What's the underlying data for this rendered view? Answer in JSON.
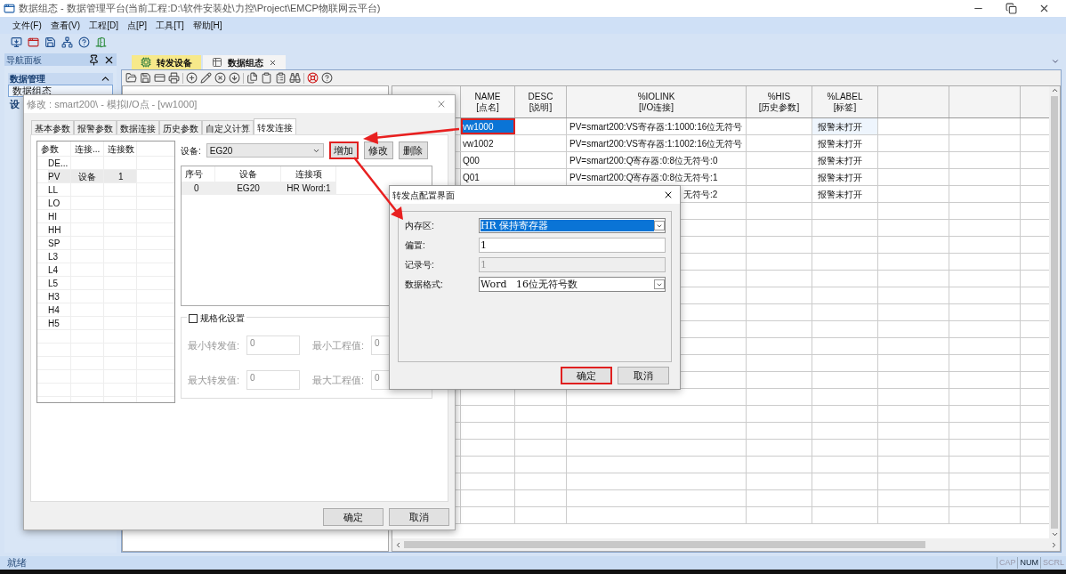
{
  "window": {
    "title": "数据组态 - 数据管理平台(当前工程:D:\\软件安装处\\力控\\Project\\EMCP物联网云平台)"
  },
  "menu": [
    "文件(F)",
    "查看(V)",
    "工程[D]",
    "点[P]",
    "工具[T]",
    "帮助[H]"
  ],
  "nav_panel": {
    "title": "导航面板",
    "section": "数据管理",
    "items": [
      {
        "label": "数据组态",
        "selected": true
      }
    ],
    "section_2": "设"
  },
  "doc_tabs": [
    {
      "label": "转发设备",
      "selected": false,
      "closable": false
    },
    {
      "label": "数据组态",
      "selected": true,
      "closable": true
    }
  ],
  "grid": {
    "columns": [
      {
        "name": "NAME",
        "sub": "[点名]"
      },
      {
        "name": "DESC",
        "sub": "[说明]"
      },
      {
        "name": "%IOLINK",
        "sub": "[I/O连接]"
      },
      {
        "name": "%HIS",
        "sub": "[历史参数]"
      },
      {
        "name": "%LABEL",
        "sub": "[标签]"
      }
    ],
    "rows": [
      {
        "name": "vw1000",
        "selected": true,
        "iolink": "PV=smart200:VS寄存器:1:1000:16位无符号",
        "label": "报警未打开"
      },
      {
        "name": "vw1002",
        "selected": false,
        "iolink": "PV=smart200:VS寄存器:1:1002:16位无符号",
        "label": "报警未打开"
      },
      {
        "name": "Q00",
        "selected": false,
        "iolink": "PV=smart200:Q寄存器:0:8位无符号:0",
        "label": "报警未打开"
      },
      {
        "name": "Q01",
        "selected": false,
        "iolink": "PV=smart200:Q寄存器:0:8位无符号:1",
        "label": "报警未打开"
      },
      {
        "selected": false,
        "iolink": "无符号:2",
        "label": "报警未打开"
      }
    ]
  },
  "status_bar": {
    "text": "就绪",
    "indicators": [
      {
        "label": "CAP",
        "on": false
      },
      {
        "label": "NUM",
        "on": true
      },
      {
        "label": "SCRL",
        "on": false
      }
    ]
  },
  "dialog": {
    "title": "修改 : smart200\\ - 模拟I/O点 - [vw1000]",
    "tabs": [
      {
        "label": "基本参数",
        "selected": false
      },
      {
        "label": "报警参数",
        "selected": false
      },
      {
        "label": "数据连接",
        "selected": false
      },
      {
        "label": "历史参数",
        "selected": false
      },
      {
        "label": "自定义计算",
        "selected": false
      },
      {
        "label": "转发连接",
        "selected": true
      }
    ],
    "params": {
      "columns": [
        "参数",
        "连接...",
        "连接数"
      ],
      "rows": [
        {
          "param": "DE...",
          "selected": false
        },
        {
          "param": "PV",
          "conn": "设备",
          "count": "1",
          "selected": true
        },
        {
          "param": "LL",
          "selected": false
        },
        {
          "param": "LO",
          "selected": false
        },
        {
          "param": "HI",
          "selected": false
        },
        {
          "param": "HH",
          "selected": false
        },
        {
          "param": "SP",
          "selected": false
        },
        {
          "param": "L3",
          "selected": false
        },
        {
          "param": "L4",
          "selected": false
        },
        {
          "param": "L5",
          "selected": false
        },
        {
          "param": "H3",
          "selected": false
        },
        {
          "param": "H4",
          "selected": false
        },
        {
          "param": "H5",
          "selected": false
        }
      ]
    },
    "device_label": "设备:",
    "device_value": "EG20",
    "buttons": [
      {
        "label": "增加",
        "highlighted": true
      },
      {
        "label": "修改",
        "highlighted": false
      },
      {
        "label": "删除",
        "highlighted": false
      }
    ],
    "links": {
      "columns": [
        "序号",
        "设备",
        "连接项"
      ],
      "rows": [
        {
          "index": "0",
          "device": "EG20",
          "item": "HR Word:1"
        }
      ]
    },
    "normalize": {
      "label": "规格化设置",
      "checked": false,
      "fields": [
        {
          "label": "最小转发值:",
          "value": "0"
        },
        {
          "label": "最小工程值:",
          "value": "0"
        },
        {
          "label": "最大转发值:",
          "value": "0"
        },
        {
          "label": "最大工程值:",
          "value": "0"
        }
      ]
    },
    "footer_buttons": [
      "确定",
      "取消"
    ]
  },
  "dialog_2": {
    "title": "转发点配置界面",
    "fields": [
      {
        "label": "内存区:",
        "kind": "select",
        "value": "HR 保持寄存器",
        "selected": true,
        "disabled": false
      },
      {
        "label": "偏置:",
        "kind": "input",
        "value": "1",
        "selected": false,
        "disabled": false
      },
      {
        "label": "记录号:",
        "kind": "input",
        "value": "1",
        "selected": false,
        "disabled": true
      },
      {
        "label": "数据格式:",
        "kind": "select",
        "value": "Word   16位无符号数",
        "selected": false,
        "disabled": false
      }
    ],
    "buttons": [
      {
        "label": "确定",
        "highlighted": true
      },
      {
        "label": "取消",
        "highlighted": false
      }
    ]
  }
}
